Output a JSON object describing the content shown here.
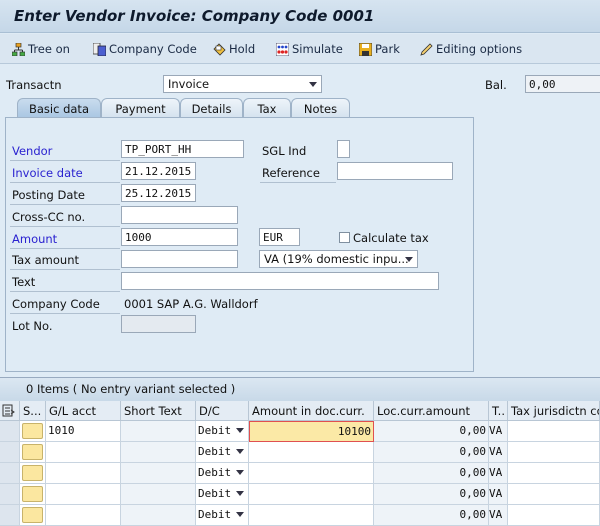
{
  "window": {
    "title": "Enter Vendor Invoice: Company Code 0001"
  },
  "toolbar": [
    {
      "label": "Tree on",
      "icon": "tree-icon"
    },
    {
      "label": "Company Code",
      "icon": "company-code-icon"
    },
    {
      "label": "Hold",
      "icon": "hold-icon"
    },
    {
      "label": "Simulate",
      "icon": "simulate-icon"
    },
    {
      "label": "Park",
      "icon": "save-icon"
    },
    {
      "label": "Editing options",
      "icon": "pencil-icon"
    }
  ],
  "header": {
    "transaction_label": "Transactn",
    "transaction_value": "Invoice",
    "balance_label": "Bal.",
    "balance_value": "0,00"
  },
  "tabs": [
    {
      "label": "Basic data",
      "active": true
    },
    {
      "label": "Payment"
    },
    {
      "label": "Details"
    },
    {
      "label": "Tax"
    },
    {
      "label": "Notes"
    }
  ],
  "form": {
    "vendor_label": "Vendor",
    "vendor": "TP_PORT_HH",
    "sgl_label": "SGL Ind",
    "sgl": "",
    "invoice_date_label": "Invoice date",
    "invoice_date": "21.12.2015",
    "reference_label": "Reference",
    "reference": "",
    "posting_date_label": "Posting Date",
    "posting_date": "25.12.2015",
    "crosscc_label": "Cross-CC no.",
    "crosscc": "",
    "amount_label": "Amount",
    "amount": "1000",
    "currency": "EUR",
    "calc_tax_label": "Calculate tax",
    "calc_tax": false,
    "tax_amount_label": "Tax amount",
    "tax_amount": "",
    "tax_code": "VA (19% domestic inpu...",
    "text_label": "Text",
    "text": "",
    "company_code_label": "Company Code",
    "company_code": "0001 SAP A.G. Walldorf",
    "lot_label": "Lot No.",
    "lot": ""
  },
  "grid": {
    "header": "0 Items ( No entry variant selected )",
    "columns": [
      "S...",
      "G/L acct",
      "Short Text",
      "D/C",
      "Amount in doc.curr.",
      "Loc.curr.amount",
      "T..",
      "Tax jurisdictn co"
    ],
    "rows": [
      {
        "gl": "1010",
        "text": "",
        "dc": "Debit",
        "amount": "10100",
        "loc": "0,00",
        "tax": "VA"
      },
      {
        "gl": "",
        "text": "",
        "dc": "Debit",
        "amount": "",
        "loc": "0,00",
        "tax": "VA"
      },
      {
        "gl": "",
        "text": "",
        "dc": "Debit",
        "amount": "",
        "loc": "0,00",
        "tax": "VA"
      },
      {
        "gl": "",
        "text": "",
        "dc": "Debit",
        "amount": "",
        "loc": "0,00",
        "tax": "VA"
      },
      {
        "gl": "",
        "text": "",
        "dc": "Debit",
        "amount": "",
        "loc": "0,00",
        "tax": "VA"
      }
    ]
  }
}
